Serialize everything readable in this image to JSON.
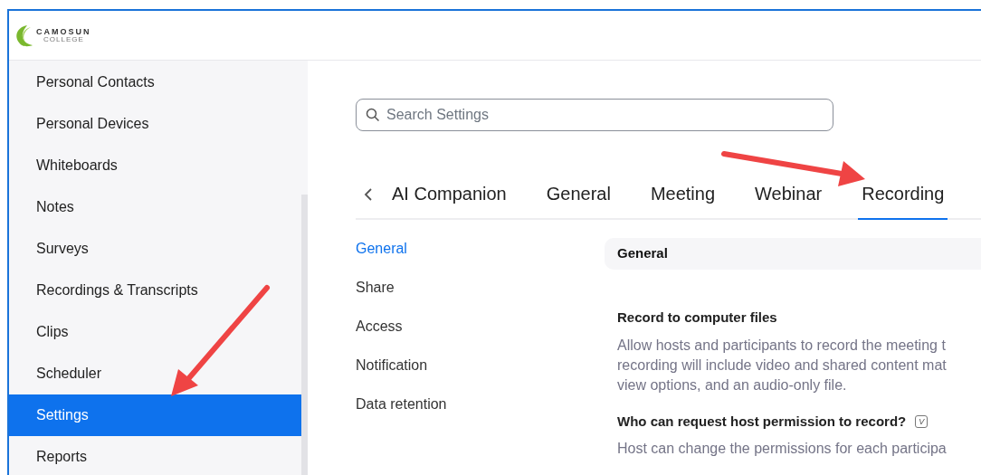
{
  "logo": {
    "name": "CAMOSUN",
    "subtitle": "COLLEGE"
  },
  "sidebar": {
    "items": [
      {
        "label": "Personal Contacts",
        "selected": false
      },
      {
        "label": "Personal Devices",
        "selected": false
      },
      {
        "label": "Whiteboards",
        "selected": false
      },
      {
        "label": "Notes",
        "selected": false
      },
      {
        "label": "Surveys",
        "selected": false
      },
      {
        "label": "Recordings & Transcripts",
        "selected": false
      },
      {
        "label": "Clips",
        "selected": false
      },
      {
        "label": "Scheduler",
        "selected": false
      },
      {
        "label": "Settings",
        "selected": true
      },
      {
        "label": "Reports",
        "selected": false
      }
    ]
  },
  "search": {
    "placeholder": "Search Settings"
  },
  "tabs": [
    {
      "label": "AI Companion",
      "selected": false
    },
    {
      "label": "General",
      "selected": false
    },
    {
      "label": "Meeting",
      "selected": false
    },
    {
      "label": "Webinar",
      "selected": false
    },
    {
      "label": "Recording",
      "selected": true
    }
  ],
  "subnav": [
    {
      "label": "General",
      "selected": true
    },
    {
      "label": "Share",
      "selected": false
    },
    {
      "label": "Access",
      "selected": false
    },
    {
      "label": "Notification",
      "selected": false
    },
    {
      "label": "Data retention",
      "selected": false
    }
  ],
  "section": {
    "title": "General",
    "settings": [
      {
        "title": "Record to computer files",
        "description": [
          "Allow hosts and participants to record the meeting t",
          "recording will include video and shared content mat",
          "view options, and an audio-only file."
        ]
      },
      {
        "title": "Who can request host permission to record?",
        "badge": "V",
        "description": [
          "Host can change the permissions for each participa"
        ]
      }
    ]
  }
}
